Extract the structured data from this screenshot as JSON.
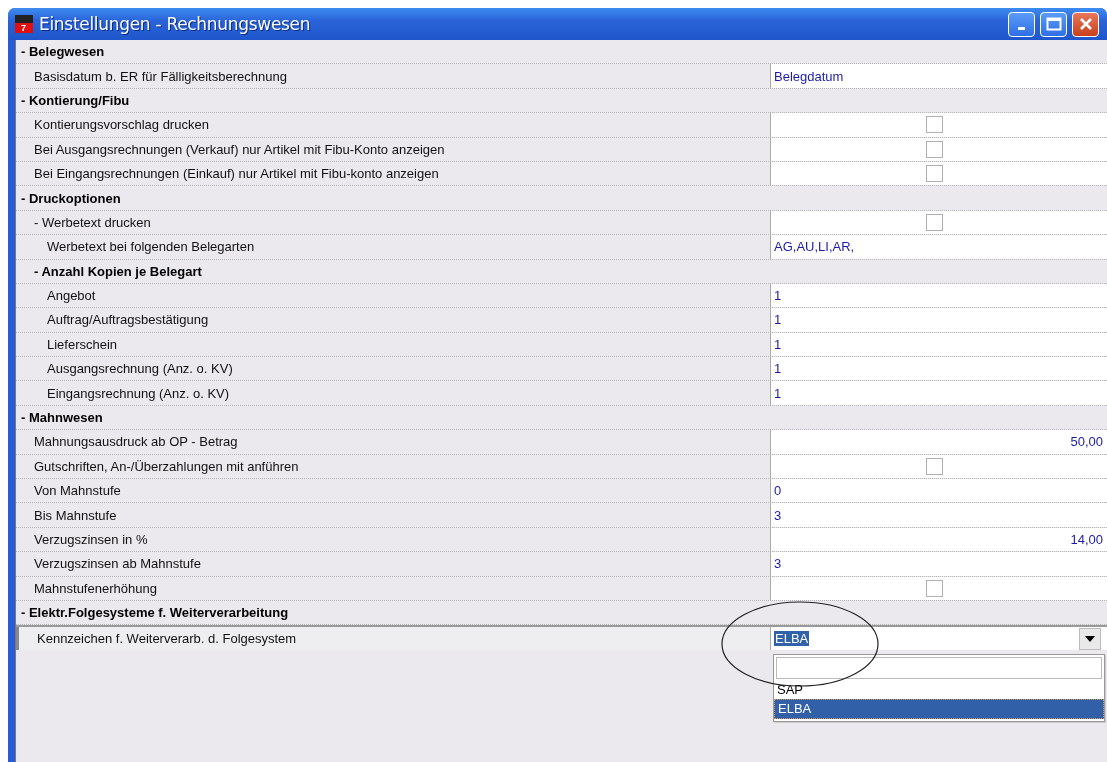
{
  "window": {
    "title": "Einstellungen - Rechnungswesen",
    "icon_number": "7"
  },
  "sections": [
    {
      "label": "- Belegwesen",
      "kind": "heading",
      "children": [
        {
          "label": "Basisdatum b. ER für Fälligkeitsberechnung",
          "kind": "text",
          "value": "Belegdatum"
        }
      ]
    },
    {
      "label": "- Kontierung/Fibu",
      "kind": "heading",
      "children": [
        {
          "label": "Kontierungsvorschlag drucken",
          "kind": "checkbox",
          "checked": false
        },
        {
          "label": "Bei Ausgangsrechnungen (Verkauf) nur Artikel mit Fibu-Konto anzeigen",
          "kind": "checkbox",
          "checked": false
        },
        {
          "label": "Bei Eingangsrechnungen (Einkauf) nur Artikel mit Fibu-konto anzeigen",
          "kind": "checkbox",
          "checked": false
        }
      ]
    },
    {
      "label": "- Druckoptionen",
      "kind": "heading",
      "children": [
        {
          "label": "- Werbetext drucken",
          "kind": "checkbox",
          "checked": false,
          "children": [
            {
              "label": "Werbetext bei folgenden Belegarten",
              "kind": "text",
              "value": "AG,AU,LI,AR,"
            }
          ]
        },
        {
          "label": "- Anzahl Kopien je Belegart",
          "kind": "heading",
          "children": [
            {
              "label": "Angebot",
              "kind": "text",
              "value": "1"
            },
            {
              "label": "Auftrag/Auftragsbestätigung",
              "kind": "text",
              "value": "1"
            },
            {
              "label": "Lieferschein",
              "kind": "text",
              "value": "1"
            },
            {
              "label": "Ausgangsrechnung (Anz. o. KV)",
              "kind": "text",
              "value": "1"
            },
            {
              "label": "Eingangsrechnung (Anz. o. KV)",
              "kind": "text",
              "value": "1"
            }
          ]
        }
      ]
    },
    {
      "label": "- Mahnwesen",
      "kind": "heading",
      "children": [
        {
          "label": "Mahnungsausdruck ab OP - Betrag",
          "kind": "number",
          "value": "50,00"
        },
        {
          "label": "Gutschriften, An-/Überzahlungen mit anführen",
          "kind": "checkbox",
          "checked": false
        },
        {
          "label": "Von Mahnstufe",
          "kind": "text",
          "value": "0"
        },
        {
          "label": "Bis Mahnstufe",
          "kind": "text",
          "value": "3"
        },
        {
          "label": "Verzugszinsen in %",
          "kind": "number",
          "value": "14,00"
        },
        {
          "label": "Verzugszinsen ab Mahnstufe",
          "kind": "text",
          "value": "3"
        },
        {
          "label": "Mahnstufenerhöhung",
          "kind": "checkbox",
          "checked": false
        }
      ]
    },
    {
      "label": "- Elektr.Folgesysteme f. Weiterverarbeitung",
      "kind": "heading",
      "children": [
        {
          "label": "Kennzeichen f. Weiterverarb. d. Folgesystem",
          "kind": "dropdown",
          "value": "ELBA"
        }
      ]
    }
  ],
  "dropdown_list": {
    "options": [
      {
        "label": "SAP",
        "selected": false
      },
      {
        "label": "ELBA",
        "selected": true
      }
    ]
  }
}
